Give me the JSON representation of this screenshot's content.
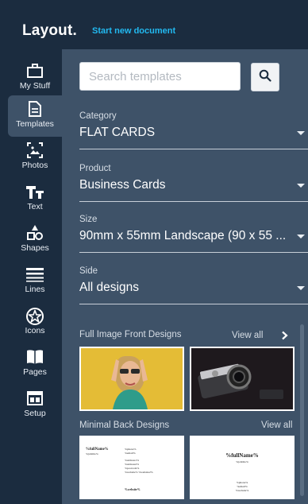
{
  "app": {
    "logo": "Layout.",
    "start_new": "Start new document"
  },
  "rail": [
    {
      "label": "My Stuff",
      "icon": "briefcase-icon",
      "active": false
    },
    {
      "label": "Templates",
      "icon": "document-icon",
      "active": true
    },
    {
      "label": "Photos",
      "icon": "photo-icon",
      "active": false
    },
    {
      "label": "Text",
      "icon": "text-icon",
      "active": false
    },
    {
      "label": "Shapes",
      "icon": "shapes-icon",
      "active": false
    },
    {
      "label": "Lines",
      "icon": "lines-icon",
      "active": false
    },
    {
      "label": "Icons",
      "icon": "star-badge-icon",
      "active": false
    },
    {
      "label": "Pages",
      "icon": "book-icon",
      "active": false
    },
    {
      "label": "Setup",
      "icon": "setup-icon",
      "active": false
    }
  ],
  "search": {
    "placeholder": "Search templates",
    "value": ""
  },
  "filters": {
    "category": {
      "label": "Category",
      "value": "FLAT CARDS"
    },
    "product": {
      "label": "Product",
      "value": "Business Cards"
    },
    "size": {
      "label": "Size",
      "value": "90mm x 55mm Landscape (90 x 55 ..."
    },
    "side": {
      "label": "Side",
      "value": "All designs"
    }
  },
  "sections": {
    "front": {
      "title": "Full Image Front Designs",
      "view_all": "View all"
    },
    "back": {
      "title": "Minimal Back Designs",
      "view_all": "View all"
    }
  },
  "back_cards": {
    "card1": {
      "name": "%fullName%",
      "jobtitle": "%jobtitle%",
      "col2": [
        "%phone%",
        "%email%"
      ],
      "col3": [
        "%address1%",
        "%address2%",
        "%postcode%",
        "%website% %website2%"
      ],
      "footer": "%website%"
    },
    "card2": {
      "name": "%fullName%",
      "jobtitle": "%jobtitle%",
      "lines": [
        "%phone%",
        "%email%",
        "%website%"
      ]
    }
  },
  "colors": {
    "background": "#1b2c3f",
    "panel": "#3e5268",
    "accent": "#22b9f0"
  }
}
